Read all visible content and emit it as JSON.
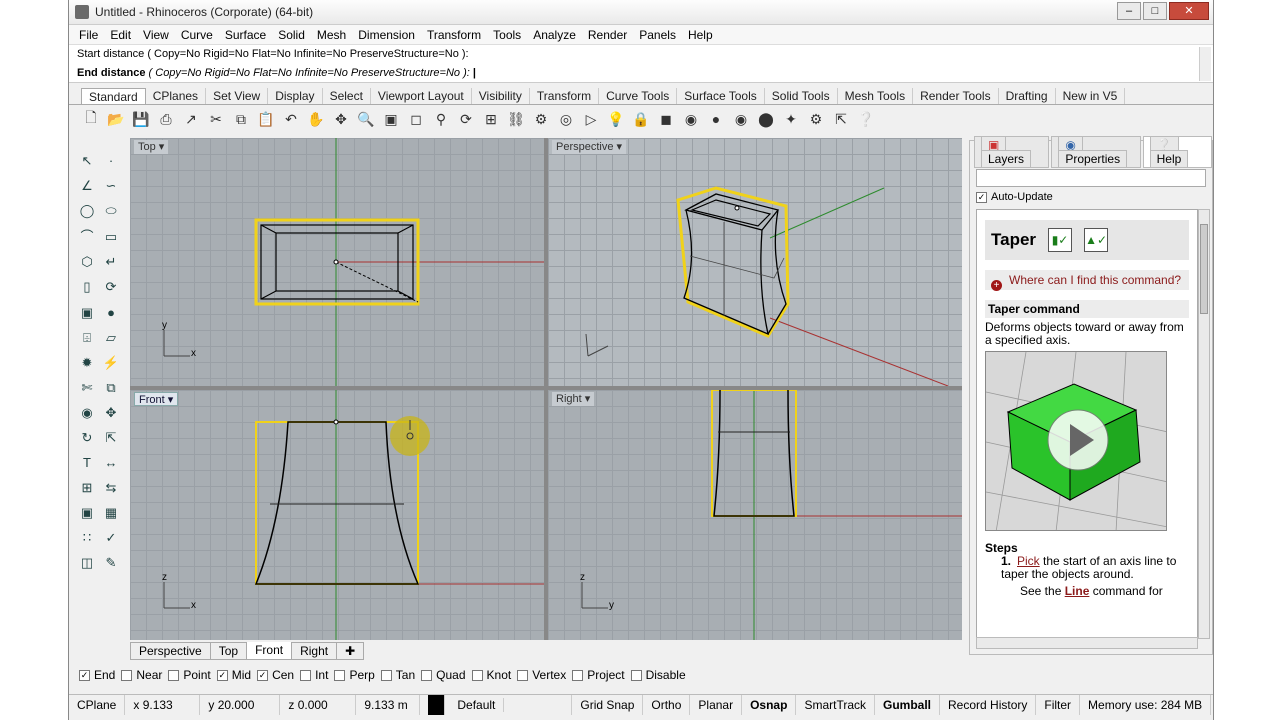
{
  "window": {
    "title": "Untitled - Rhinoceros (Corporate) (64-bit)"
  },
  "menu": [
    "File",
    "Edit",
    "View",
    "Curve",
    "Surface",
    "Solid",
    "Mesh",
    "Dimension",
    "Transform",
    "Tools",
    "Analyze",
    "Render",
    "Panels",
    "Help"
  ],
  "command": {
    "line1": "Start distance ( Copy=No  Rigid=No  Flat=No  Infinite=No  PreserveStructure=No ):",
    "line2_prefix": "End distance",
    "line2_options": "( Copy=No  Rigid=No  Flat=No  Infinite=No  PreserveStructure=No ):"
  },
  "toolbar_tabs": [
    "Standard",
    "CPlanes",
    "Set View",
    "Display",
    "Select",
    "Viewport Layout",
    "Visibility",
    "Transform",
    "Curve Tools",
    "Surface Tools",
    "Solid Tools",
    "Mesh Tools",
    "Render Tools",
    "Drafting",
    "New in V5"
  ],
  "viewports": {
    "top": "Top",
    "perspective": "Perspective",
    "front": "Front",
    "right": "Right",
    "axis_x": "x",
    "axis_y": "y",
    "axis_z": "z"
  },
  "viewport_tabs": [
    "Perspective",
    "Top",
    "Front",
    "Right"
  ],
  "panel": {
    "tabs": [
      "Layers",
      "Properties",
      "Help"
    ],
    "auto_update": "Auto-Update",
    "help": {
      "title": "Taper",
      "where": "Where can I find this command?",
      "section": "Taper command",
      "description": "Deforms objects toward or away from a specified axis.",
      "steps_title": "Steps",
      "step1_num": "1.",
      "step1_link": "Pick",
      "step1_text": " the start of an axis line to taper the objects around.",
      "step1_see": "See the ",
      "step1_see_link": "Line",
      "step1_see_text": " command for"
    }
  },
  "osnaps": [
    {
      "label": "End",
      "checked": true
    },
    {
      "label": "Near",
      "checked": false
    },
    {
      "label": "Point",
      "checked": false
    },
    {
      "label": "Mid",
      "checked": true
    },
    {
      "label": "Cen",
      "checked": true
    },
    {
      "label": "Int",
      "checked": false
    },
    {
      "label": "Perp",
      "checked": false
    },
    {
      "label": "Tan",
      "checked": false
    },
    {
      "label": "Quad",
      "checked": false
    },
    {
      "label": "Knot",
      "checked": false
    },
    {
      "label": "Vertex",
      "checked": false
    },
    {
      "label": "Project",
      "checked": false
    },
    {
      "label": "Disable",
      "checked": false
    }
  ],
  "status": {
    "cplane": "CPlane",
    "x": "x 9.133",
    "y": "y 20.000",
    "z": "z 0.000",
    "dist": "9.133 m",
    "layer": "Default",
    "grid_snap": "Grid Snap",
    "ortho": "Ortho",
    "planar": "Planar",
    "osnap": "Osnap",
    "smarttrack": "SmartTrack",
    "gumball": "Gumball",
    "record_history": "Record History",
    "filter": "Filter",
    "memory": "Memory use: 284 MB"
  },
  "colors": {
    "selection": "#f0d21a",
    "x_axis": "#a83232",
    "y_axis": "#2e8b2e",
    "viewport_bg": "#a8aeb3",
    "help_box": "#2ecc2e"
  }
}
